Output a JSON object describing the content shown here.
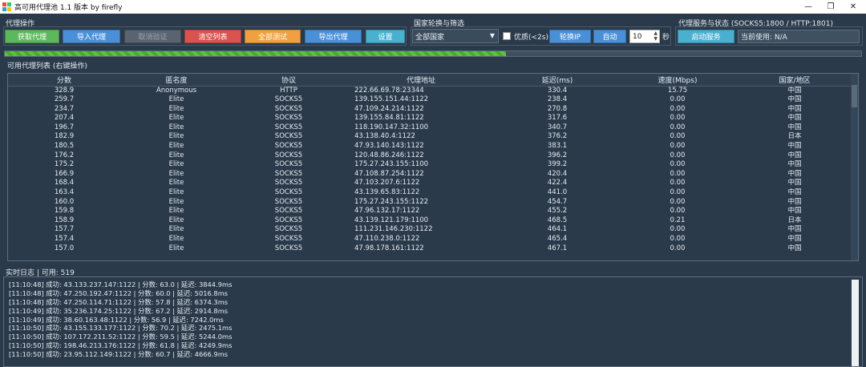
{
  "window": {
    "title": "高可用代理池 1.1 版本 by firefly",
    "minimize": "—",
    "restore": "❐",
    "close": "✕"
  },
  "proxy_ops": {
    "title": "代理操作",
    "buttons": [
      {
        "label": "获取代理",
        "color": "#5cb85c"
      },
      {
        "label": "导入代理",
        "color": "#4a90d9"
      },
      {
        "label": "取消验证",
        "color": "#5a6470"
      },
      {
        "label": "清空列表",
        "color": "#d9534f"
      },
      {
        "label": "全部测试",
        "color": "#f0a040"
      },
      {
        "label": "导出代理",
        "color": "#4a90d9"
      },
      {
        "label": "设置",
        "color": "#4ab0d0"
      }
    ]
  },
  "rotation": {
    "title": "国家轮换与筛选",
    "country_value": "全部国家",
    "quality_label": "优质(<2s)",
    "rotate_ip": "轮换IP",
    "auto": "自动",
    "interval_value": "10",
    "seconds": "秒"
  },
  "service": {
    "title": "代理服务与状态 (SOCKS5:1800 / HTTP:1801)",
    "start_label": "启动服务",
    "current_label": "当前使用: N/A"
  },
  "progress": {
    "value": 0.585
  },
  "table": {
    "title": "可用代理列表 (右键操作)",
    "columns": [
      "分数",
      "匿名度",
      "协议",
      "代理地址",
      "延迟(ms)",
      "速度(Mbps)",
      "国家/地区"
    ],
    "rows": [
      [
        "328.9",
        "Anonymous",
        "HTTP",
        "222.66.69.78:23344",
        "330.4",
        "15.75",
        "中国"
      ],
      [
        "259.7",
        "Elite",
        "SOCKS5",
        "139.155.151.44:1122",
        "238.4",
        "0.00",
        "中国"
      ],
      [
        "234.7",
        "Elite",
        "SOCKS5",
        "47.109.24.214:1122",
        "270.8",
        "0.00",
        "中国"
      ],
      [
        "207.4",
        "Elite",
        "SOCKS5",
        "139.155.84.81:1122",
        "317.6",
        "0.00",
        "中国"
      ],
      [
        "196.7",
        "Elite",
        "SOCKS5",
        "118.190.147.32:1100",
        "340.7",
        "0.00",
        "中国"
      ],
      [
        "182.9",
        "Elite",
        "SOCKS5",
        "43.138.40.4:1122",
        "376.2",
        "0.00",
        "日本"
      ],
      [
        "180.5",
        "Elite",
        "SOCKS5",
        "47.93.140.143:1122",
        "383.1",
        "0.00",
        "中国"
      ],
      [
        "176.2",
        "Elite",
        "SOCKS5",
        "120.48.86.246:1122",
        "396.2",
        "0.00",
        "中国"
      ],
      [
        "175.2",
        "Elite",
        "SOCKS5",
        "175.27.243.155:1100",
        "399.2",
        "0.00",
        "中国"
      ],
      [
        "166.9",
        "Elite",
        "SOCKS5",
        "47.108.87.254:1122",
        "420.4",
        "0.00",
        "中国"
      ],
      [
        "168.4",
        "Elite",
        "SOCKS5",
        "47.103.207.6:1122",
        "422.4",
        "0.00",
        "中国"
      ],
      [
        "163.4",
        "Elite",
        "SOCKS5",
        "43.139.65.83:1122",
        "441.0",
        "0.00",
        "中国"
      ],
      [
        "160.0",
        "Elite",
        "SOCKS5",
        "175.27.243.155:1122",
        "454.7",
        "0.00",
        "中国"
      ],
      [
        "159.8",
        "Elite",
        "SOCKS5",
        "47.96.132.17:1122",
        "455.2",
        "0.00",
        "中国"
      ],
      [
        "158.9",
        "Elite",
        "SOCKS5",
        "43.139.121.179:1100",
        "468.5",
        "0.21",
        "日本"
      ],
      [
        "157.7",
        "Elite",
        "SOCKS5",
        "111.231.146.230:1122",
        "464.1",
        "0.00",
        "中国"
      ],
      [
        "157.4",
        "Elite",
        "SOCKS5",
        "47.110.238.0:1122",
        "465.4",
        "0.00",
        "中国"
      ],
      [
        "157.0",
        "Elite",
        "SOCKS5",
        "47.98.178.161:1122",
        "467.1",
        "0.00",
        "中国"
      ]
    ]
  },
  "log": {
    "title": "实时日志 | 可用: 519",
    "lines": [
      "[11:10:48] 成功: 43.133.237.147:1122 | 分数: 63.0 | 延迟: 3844.9ms",
      "[11:10:48] 成功: 47.250.192.47:1122 | 分数: 60.0 | 延迟: 5016.8ms",
      "[11:10:48] 成功: 47.250.114.71:1122 | 分数: 57.8 | 延迟: 6374.3ms",
      "[11:10:49] 成功: 35.236.174.25:1122 | 分数: 67.2 | 延迟: 2914.8ms",
      "[11:10:49] 成功: 38.60.163.48:1122 | 分数: 56.9 | 延迟: 7242.0ms",
      "[11:10:50] 成功: 43.155.133.177:1122 | 分数: 70.2 | 延迟: 2475.1ms",
      "[11:10:50] 成功: 107.172.211.52:1122 | 分数: 59.5 | 延迟: 5244.0ms",
      "[11:10:50] 成功: 198.46.213.176:1122 | 分数: 61.8 | 延迟: 4249.9ms",
      "[11:10:50] 成功: 23.95.112.149:1122 | 分数: 60.7 | 延迟: 4666.9ms"
    ]
  }
}
